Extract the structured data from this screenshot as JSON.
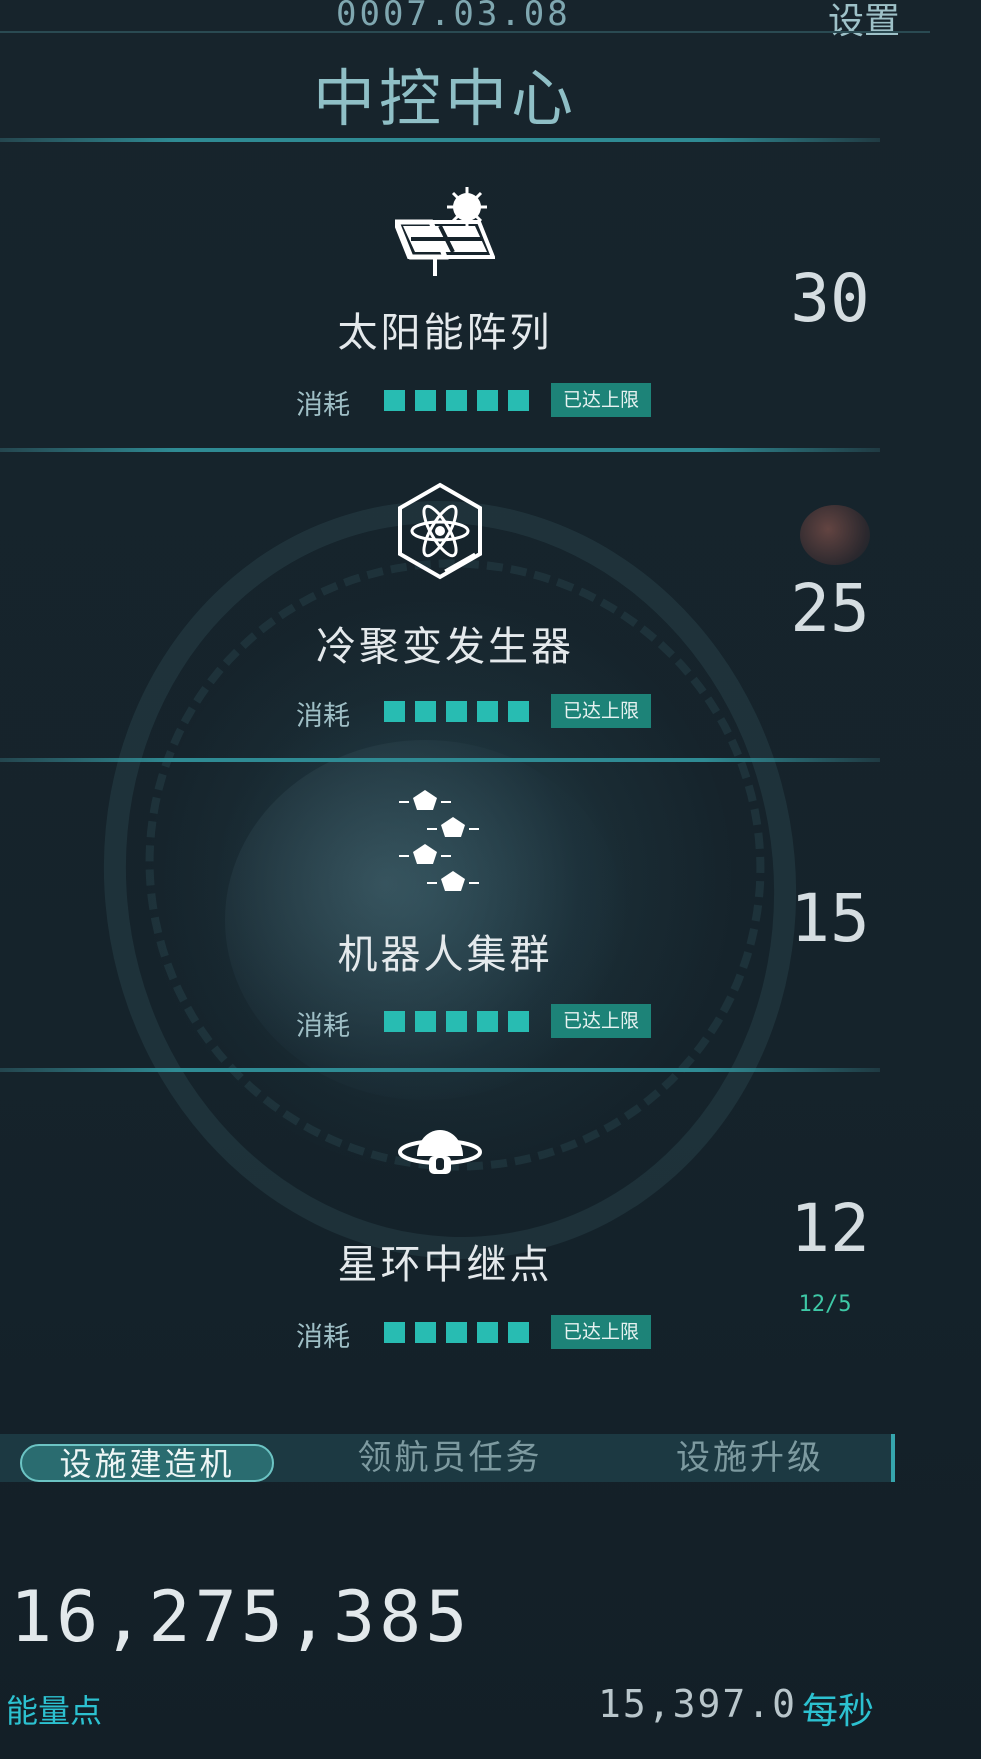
{
  "header": {
    "date": "0007.03.08",
    "settings_label": "设置",
    "title": "中控中心"
  },
  "facilities": [
    {
      "name": "太阳能阵列",
      "consume_label": "消耗",
      "status_badge": "已达上限",
      "level": "30",
      "icon": "solar-panel-icon"
    },
    {
      "name": "冷聚变发生器",
      "consume_label": "消耗",
      "status_badge": "已达上限",
      "level": "25",
      "icon": "atom-icon"
    },
    {
      "name": "机器人集群",
      "consume_label": "消耗",
      "status_badge": "已达上限",
      "level": "15",
      "icon": "robot-swarm-icon"
    },
    {
      "name": "星环中继点",
      "consume_label": "消耗",
      "status_badge": "已达上限",
      "level": "12",
      "capacity": "12/5",
      "icon": "ring-relay-icon"
    }
  ],
  "tabs": [
    {
      "label": "设施建造机",
      "active": true
    },
    {
      "label": "领航员任务",
      "active": false
    },
    {
      "label": "设施升级",
      "active": false
    }
  ],
  "resources": {
    "energy_value": "16,275,385",
    "energy_label": "能量点",
    "rate_value": "15,397.0",
    "rate_unit": "每秒"
  },
  "colors": {
    "accent": "#28bcb2",
    "badge": "#1d8378",
    "label_cyan": "#2cc1d0"
  }
}
